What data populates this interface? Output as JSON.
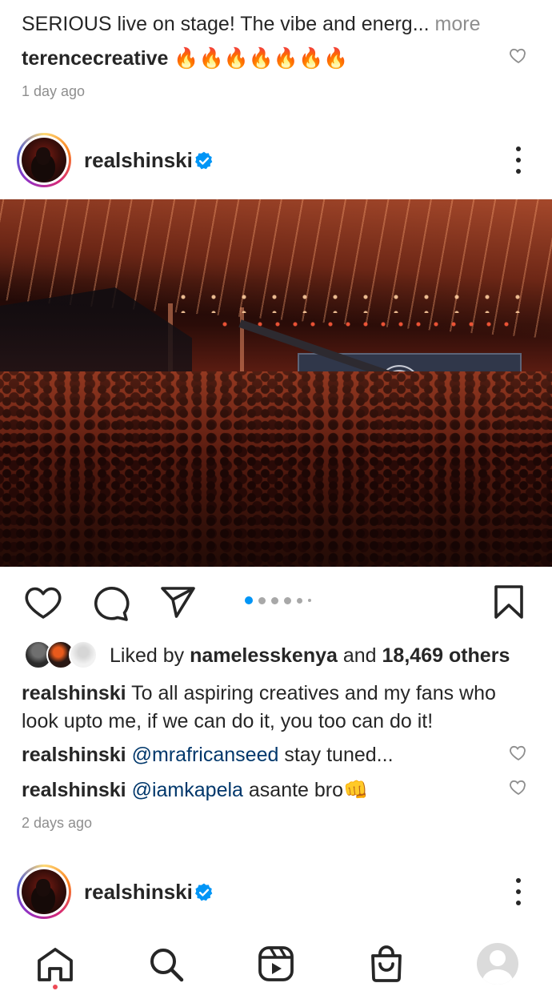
{
  "previous_post": {
    "caption_line": "SERIOUS live on stage! The vibe and energ",
    "ellipsis": "...",
    "more_label": "more",
    "comment_user": "terencecreative",
    "comment_text": "🔥🔥🔥🔥🔥🔥🔥",
    "time_ago": "1 day ago"
  },
  "post": {
    "username": "realshinski",
    "verified": true,
    "image_description_icon": "concert-photo",
    "carousel": {
      "count": 6,
      "active_index": 0
    },
    "liked_by_prefix": "Liked by ",
    "liked_by_user": "namelesskenya",
    "liked_by_joiner": " and ",
    "liked_by_others": "18,469 others",
    "caption_user": "realshinski",
    "caption_text": " To all aspiring creatives and my fans who look upto me, if we can do it, you too can do it!",
    "comments": [
      {
        "user": "realshinski",
        "mention": "@mrafricanseed",
        "text": " stay tuned..."
      },
      {
        "user": "realshinski",
        "mention": "@iamkapela",
        "text": " asante bro👊"
      }
    ],
    "time_ago": "2 days ago"
  },
  "next_post": {
    "username": "realshinski",
    "verified": true
  },
  "bottom_nav": {
    "items": [
      "home-icon",
      "search-icon",
      "reels-icon",
      "shop-icon",
      "profile-avatar"
    ],
    "active": "home-icon"
  },
  "colors": {
    "link": "#00376b",
    "verified": "#0095f6",
    "secondary_text": "#8e8e8e",
    "notification_dot": "#ed4956"
  }
}
